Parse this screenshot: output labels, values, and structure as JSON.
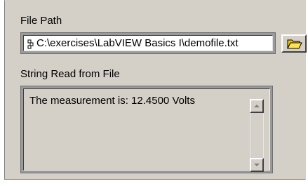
{
  "file_path": {
    "label": "File Path",
    "value": "C:\\exercises\\LabVIEW Basics I\\demofile.txt",
    "browse_icon": "folder-open-icon",
    "path_icon": "path-icon"
  },
  "string_read": {
    "label": "String Read from File",
    "value": "The measurement is: 12.4500 Volts"
  },
  "colors": {
    "panel_bg": "#d4d0c8",
    "frame": "#9a9a9a",
    "folder": "#f2c200"
  }
}
